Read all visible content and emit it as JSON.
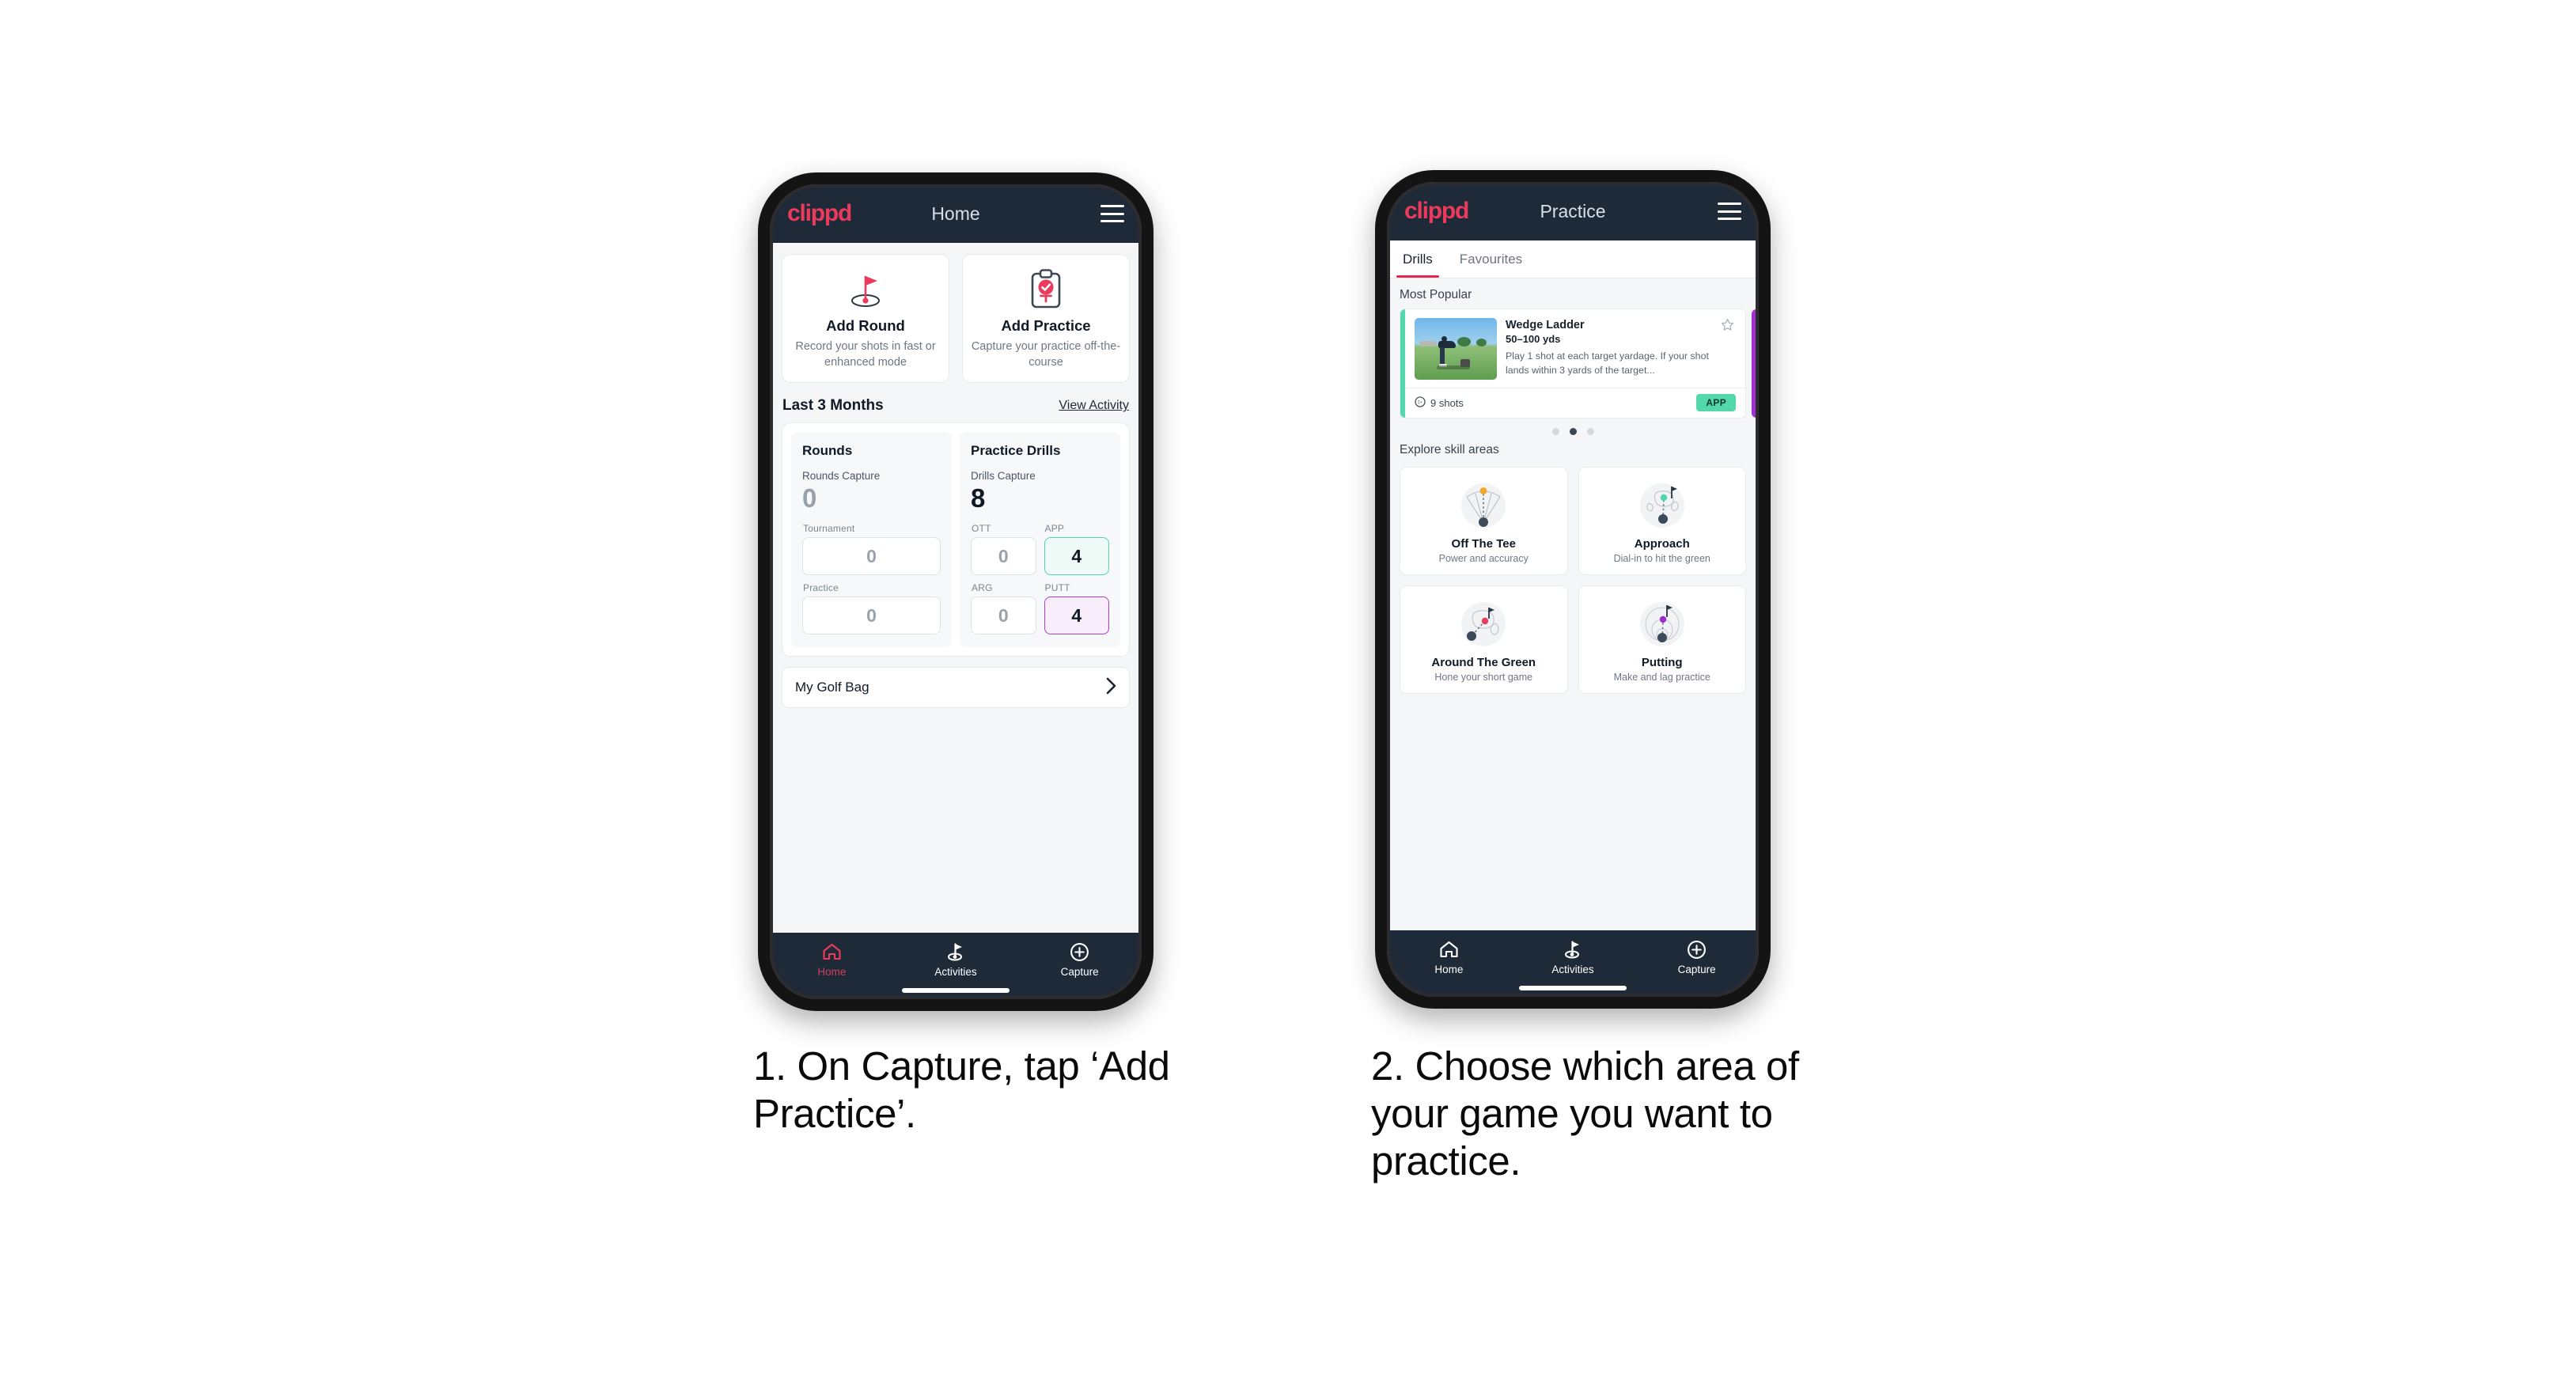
{
  "phone1": {
    "appbar": {
      "logo": "clippd",
      "title": "Home",
      "menu_icon": "hamburger-icon"
    },
    "quick_actions": [
      {
        "icon": "golf-flag-hole-icon",
        "title": "Add Round",
        "subtitle": "Record your shots in fast or enhanced mode"
      },
      {
        "icon": "clipboard-check-tee-icon",
        "title": "Add Practice",
        "subtitle": "Capture your practice off-the-course"
      }
    ],
    "section": {
      "title": "Last 3 Months",
      "link": "View Activity"
    },
    "rounds": {
      "heading": "Rounds",
      "capture_label": "Rounds Capture",
      "capture_value": "0",
      "fields": [
        {
          "label": "Tournament",
          "value": "0",
          "state": "empty"
        },
        {
          "label": "Practice",
          "value": "0",
          "state": "empty"
        }
      ]
    },
    "drills": {
      "heading": "Practice Drills",
      "capture_label": "Drills Capture",
      "capture_value": "8",
      "fields": [
        {
          "label": "OTT",
          "value": "0",
          "state": "empty"
        },
        {
          "label": "APP",
          "value": "4",
          "state": "app"
        },
        {
          "label": "ARG",
          "value": "0",
          "state": "empty"
        },
        {
          "label": "PUTT",
          "value": "4",
          "state": "putt"
        }
      ]
    },
    "golf_bag": {
      "label": "My Golf Bag",
      "chevron": "chevron-right-icon"
    },
    "bottom_nav": [
      {
        "icon": "home-icon",
        "label": "Home",
        "active": true
      },
      {
        "icon": "golf-flag-icon",
        "label": "Activities",
        "active": false
      },
      {
        "icon": "plus-circle-icon",
        "label": "Capture",
        "active": false
      }
    ]
  },
  "phone2": {
    "appbar": {
      "logo": "clippd",
      "title": "Practice",
      "menu_icon": "hamburger-icon"
    },
    "tabs": [
      {
        "label": "Drills",
        "active": true
      },
      {
        "label": "Favourites",
        "active": false
      }
    ],
    "most_popular_label": "Most Popular",
    "drill_card": {
      "title": "Wedge Ladder",
      "yardage": "50–100 yds",
      "description": "Play 1 shot at each target yardage. If your shot lands within 3 yards of the target...",
      "shots": "9 shots",
      "shots_icon": "golf-ball-icon",
      "badge": "APP",
      "star_icon": "star-outline-icon",
      "accent_color": "#53d8ac",
      "thumbnail": "golfer-chipping-photo"
    },
    "carousel_dots": {
      "count": 3,
      "active_index": 1
    },
    "explore_label": "Explore skill areas",
    "skill_areas": [
      {
        "icon": "tee-dispersion-icon",
        "title": "Off The Tee",
        "subtitle": "Power and accuracy",
        "accent": "#f0a825"
      },
      {
        "icon": "approach-green-icon",
        "title": "Approach",
        "subtitle": "Dial-in to hit the green",
        "accent": "#4fd6ab"
      },
      {
        "icon": "chip-green-icon",
        "title": "Around The Green",
        "subtitle": "Hone your short game",
        "accent": "#ec3a5d"
      },
      {
        "icon": "putting-rings-icon",
        "title": "Putting",
        "subtitle": "Make and lag practice",
        "accent": "#9b2fd0"
      }
    ],
    "bottom_nav": [
      {
        "icon": "home-icon",
        "label": "Home",
        "active": false
      },
      {
        "icon": "golf-flag-icon",
        "label": "Activities",
        "active": false
      },
      {
        "icon": "plus-circle-icon",
        "label": "Capture",
        "active": false
      }
    ]
  },
  "captions": {
    "step1": "1. On Capture, tap ‘Add Practice’.",
    "step2": "2. Choose which area of your game you want to practice."
  },
  "colors": {
    "brand_pink": "#ec3a5d",
    "dark_navy": "#1e2a38",
    "app_green": "#53d8ac",
    "putt_purple": "#b43ccd",
    "page_bg": "#f4f6f8"
  }
}
